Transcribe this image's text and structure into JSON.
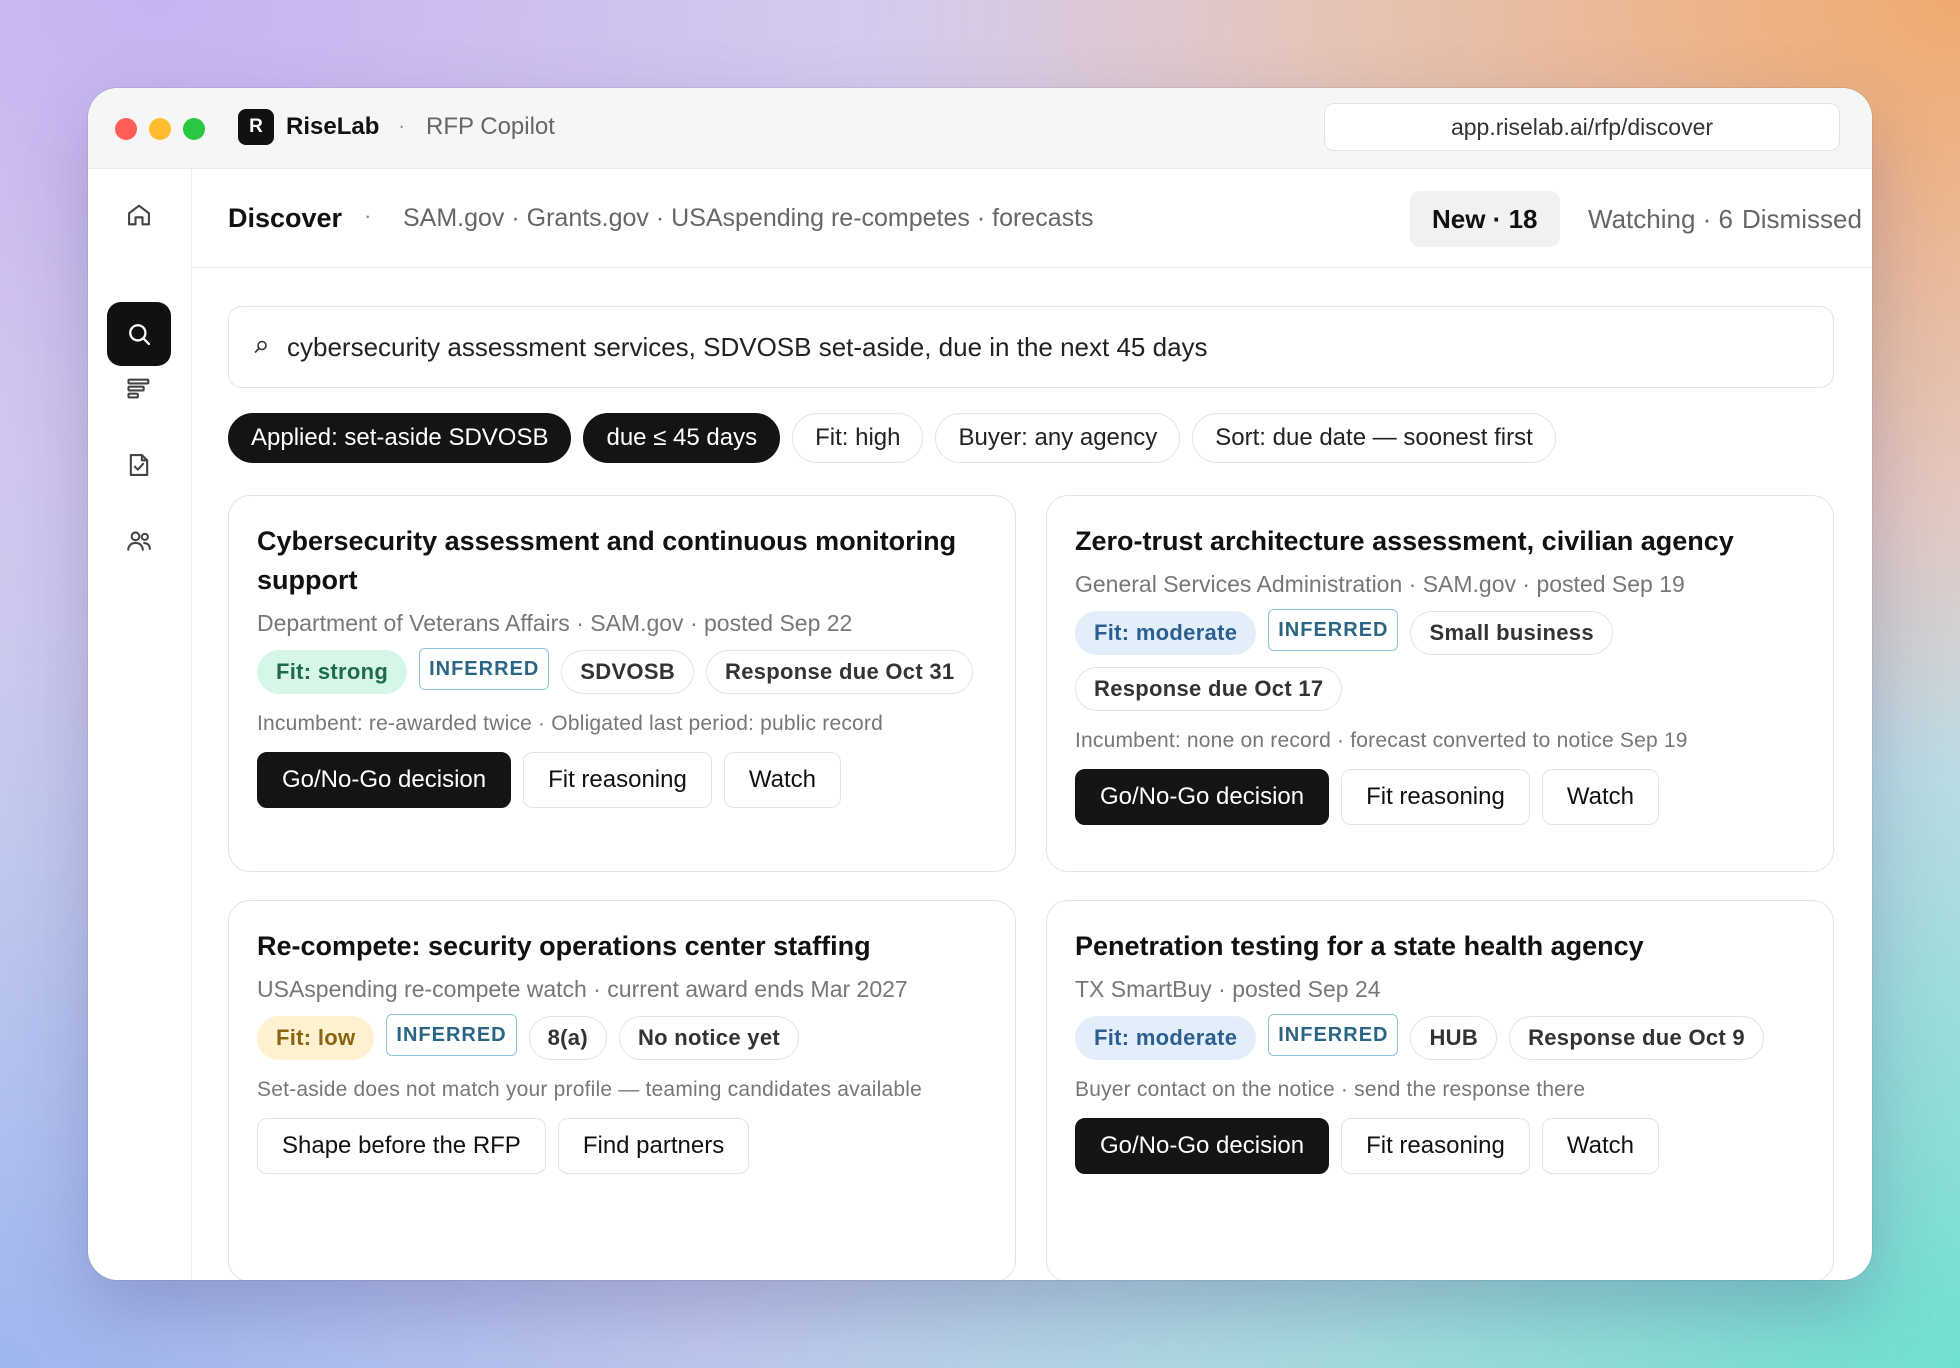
{
  "titlebar": {
    "logo_letter": "R",
    "app_name": "RiseLab",
    "separator": "·",
    "app_subtitle": "RFP Copilot",
    "url": "app.riselab.ai/rfp/discover"
  },
  "sidebar": {
    "items": [
      {
        "name": "home",
        "icon": "home-icon",
        "active": false
      },
      {
        "name": "search",
        "icon": "search-icon",
        "active": true
      },
      {
        "name": "pipeline",
        "icon": "bars-icon",
        "active": false
      },
      {
        "name": "documents",
        "icon": "document-check-icon",
        "active": false
      },
      {
        "name": "team",
        "icon": "users-icon",
        "active": false
      }
    ]
  },
  "header": {
    "title": "Discover",
    "dot": "·",
    "sources": "SAM.gov · Grants.gov · USAspending re-competes · forecasts",
    "tabs": [
      {
        "label": "New · 18",
        "active": true
      },
      {
        "label": "Watching · 6",
        "active": false
      },
      {
        "label": "Dismissed",
        "active": false
      }
    ]
  },
  "search": {
    "glyph": "⌕",
    "query": "cybersecurity assessment services, SDVOSB set-aside, due in the next 45 days"
  },
  "filters": [
    {
      "label": "Applied: set-aside SDVOSB",
      "style": "dark"
    },
    {
      "label": "due ≤ 45 days",
      "style": "dark"
    },
    {
      "label": "Fit: high",
      "style": "outline"
    },
    {
      "label": "Buyer: any agency",
      "style": "outline"
    },
    {
      "label": "Sort: due date — soonest first",
      "style": "outline"
    }
  ],
  "cards": [
    {
      "title": "Cybersecurity assessment and continuous monitoring support",
      "meta": "Department of Veterans Affairs · SAM.gov · posted Sep 22",
      "fit": "Fit: strong",
      "inferred": "INFERRED",
      "tag1": "SDVOSB",
      "tag2": "Response due Oct 31",
      "note": "Incumbent: re-awarded twice · Obligated last period: public record",
      "btn_primary": "Go/No-Go decision",
      "btn_2": "Fit reasoning",
      "btn_3": "Watch"
    },
    {
      "title": "Zero-trust architecture assessment, civilian agency",
      "meta": "General Services Administration · SAM.gov · posted Sep 19",
      "fit": "Fit: moderate",
      "inferred": "INFERRED",
      "tag1": "Small business",
      "tag2": "Response due Oct 17",
      "note": "Incumbent: none on record · forecast converted to notice Sep 19",
      "btn_primary": "Go/No-Go decision",
      "btn_2": "Fit reasoning",
      "btn_3": "Watch"
    },
    {
      "title": "Re-compete: security operations center staffing",
      "meta": "USAspending re-compete watch · current award ends Mar 2027",
      "fit": "Fit: low",
      "inferred": "INFERRED",
      "tag1": "8(a)",
      "tag2": "No notice yet",
      "note": "Set-aside does not match your profile — teaming candidates available",
      "btn_1": "Shape before the RFP",
      "btn_2": "Find partners"
    },
    {
      "title": "Penetration testing for a state health agency",
      "meta": "TX SmartBuy · posted Sep 24",
      "fit": "Fit: moderate",
      "inferred": "INFERRED",
      "tag1": "HUB",
      "tag2": "Response due Oct 9",
      "note": "Buyer contact on the notice · send the response there",
      "btn_primary": "Go/No-Go decision",
      "btn_2": "Fit reasoning",
      "btn_3": "Watch"
    }
  ],
  "colors": {
    "accent_dark": "#141414",
    "fit_strong_bg": "#d6f6e8",
    "fit_moderate_bg": "#e2effb",
    "fit_low_bg": "#fdf1cf",
    "inferred_border": "#8ec3de"
  }
}
